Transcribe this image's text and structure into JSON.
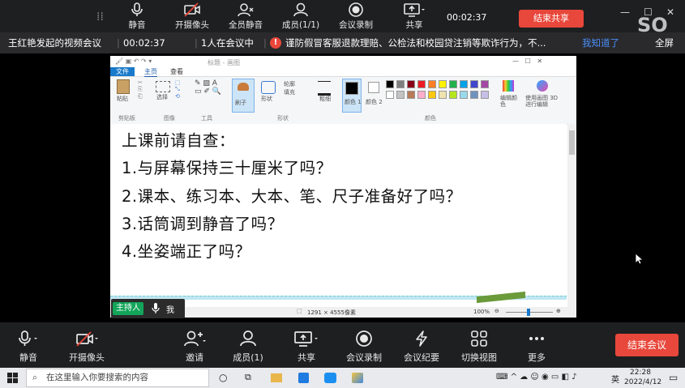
{
  "top_toolbar": {
    "mute_label": "静音",
    "camera_label": "开摄像头",
    "mute_all_label": "全员静音",
    "members_label": "成员(1/1)",
    "record_label": "会议录制",
    "share_label": "共享",
    "timer": "00:02:37",
    "end_share_label": "结束共享"
  },
  "info_bar": {
    "meeting_title": "王红艳发起的视频会议",
    "elapsed": "00:02:37",
    "attendee_count": "1人在会议中",
    "notice": "谨防假冒客服退款理赔、公检法和校园贷注销等欺诈行为，不...",
    "ack_link": "我知道了",
    "fullscreen_label": "全屏",
    "watermark": "SO"
  },
  "paint": {
    "window_title": "标题 - 画图",
    "tabs": [
      "文件",
      "主页",
      "查看"
    ],
    "ribbon": {
      "paste_label": "粘贴",
      "select_label": "选择",
      "brush_label": "刷子",
      "shapes_label": "形状",
      "outline_label": "轮廓",
      "fill_label": "填充",
      "size_label": "粗细",
      "color1_label": "颜色 1",
      "color2_label": "颜色 2",
      "edit_colors_label": "编辑颜色",
      "paint3d_label": "使用画图 3D 进行编辑",
      "group_clipboard": "剪贴板",
      "group_image": "图像",
      "group_tools": "工具",
      "group_shapes": "形状",
      "group_colors": "颜色"
    },
    "palette": [
      "#000000",
      "#7f7f7f",
      "#880015",
      "#ed1c24",
      "#ff7f27",
      "#fff200",
      "#22b14c",
      "#00a2e8",
      "#3f48cc",
      "#a349a4",
      "#ffffff",
      "#c3c3c3",
      "#b97a57",
      "#ffaec9",
      "#ffc90e",
      "#efe4b0",
      "#b5e61d",
      "#99d9ea",
      "#7092be",
      "#c8bfe7"
    ],
    "canvas_lines": [
      "上课前请自查：",
      "1.与屏幕保持三十厘米了吗？",
      "2.课本、练习本、大本、笔、尺子准备好了吗？",
      "3.话筒调到静音了吗？",
      "4.坐姿端正了吗？"
    ],
    "status_size": "1291 × 4555像素",
    "zoom": "100%"
  },
  "host_tag": {
    "badge": "主持人",
    "name": "我"
  },
  "bottom_toolbar": {
    "mute_label": "静音",
    "camera_label": "开摄像头",
    "invite_label": "邀请",
    "members_label": "成员(1)",
    "share_label": "共享",
    "record_label": "会议录制",
    "minutes_label": "会议纪要",
    "switch_view_label": "切换视图",
    "more_label": "更多",
    "end_meeting_label": "结束会议"
  },
  "taskbar": {
    "search_placeholder": "在这里输入你要搜索的内容",
    "ime": "英",
    "time": "22:28",
    "date": "2022/4/12"
  }
}
